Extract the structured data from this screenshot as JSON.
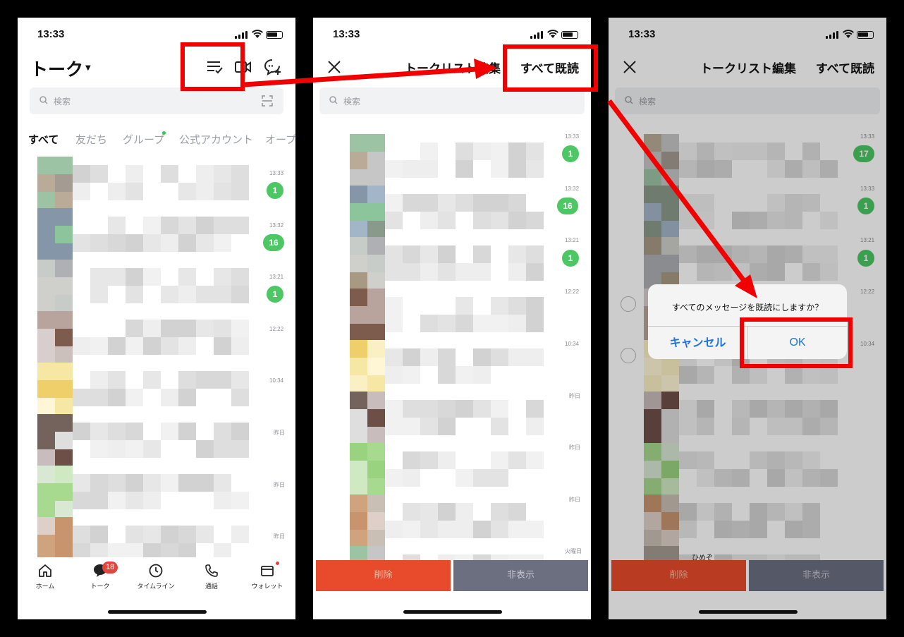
{
  "status": {
    "time": "13:33"
  },
  "screen1": {
    "title": "トーク",
    "search_placeholder": "検索",
    "tabs": [
      "すべて",
      "友だち",
      "グループ",
      "公式アカウント",
      "オープ"
    ],
    "rows": [
      {
        "time": "13:33",
        "badge": "1"
      },
      {
        "time": "13:32",
        "badge": "16"
      },
      {
        "time": "13:21",
        "badge": "1"
      },
      {
        "time": "12:22",
        "badge": ""
      },
      {
        "time": "10:34",
        "badge": ""
      },
      {
        "time": "昨日",
        "badge": ""
      },
      {
        "time": "昨日",
        "badge": ""
      },
      {
        "time": "昨日",
        "badge": ""
      }
    ],
    "nav": {
      "home": "ホーム",
      "talk": "トーク",
      "talk_badge": "18",
      "timeline": "タイムライン",
      "call": "通話",
      "wallet": "ウォレット"
    }
  },
  "screen2": {
    "title": "トークリスト編集",
    "read_all": "すべて既読",
    "search_placeholder": "検索",
    "rows": [
      {
        "time": "13:33",
        "badge": "1"
      },
      {
        "time": "13:32",
        "badge": "16"
      },
      {
        "time": "13:21",
        "badge": "1"
      },
      {
        "time": "12:22",
        "badge": ""
      },
      {
        "time": "10:34",
        "badge": ""
      },
      {
        "time": "昨日",
        "badge": ""
      },
      {
        "time": "昨日",
        "badge": ""
      },
      {
        "time": "昨日",
        "badge": ""
      },
      {
        "time": "火曜日",
        "badge": ""
      }
    ],
    "delete_label": "削除",
    "hide_label": "非表示"
  },
  "screen3": {
    "title": "トークリスト編集",
    "read_all": "すべて既読",
    "search_placeholder": "検索",
    "rows": [
      {
        "time": "13:33",
        "badge": "17"
      },
      {
        "time": "13:33",
        "badge": "1"
      },
      {
        "time": "13:21",
        "badge": "1"
      },
      {
        "time": "12:22",
        "badge": ""
      },
      {
        "time": "10:34",
        "badge": ""
      }
    ],
    "partial_name": "ひめぞ",
    "dialog": {
      "message": "すべてのメッセージを既読にしますか？",
      "cancel": "キャンセル",
      "ok": "OK"
    },
    "delete_label": "削除",
    "hide_label": "非表示"
  },
  "colors": {
    "highlight": "#f20000",
    "badge_green": "#4cc764",
    "delete_red": "#e84b2b",
    "hide_gray": "#6b6f80",
    "dialog_blue": "#1e74e0"
  }
}
